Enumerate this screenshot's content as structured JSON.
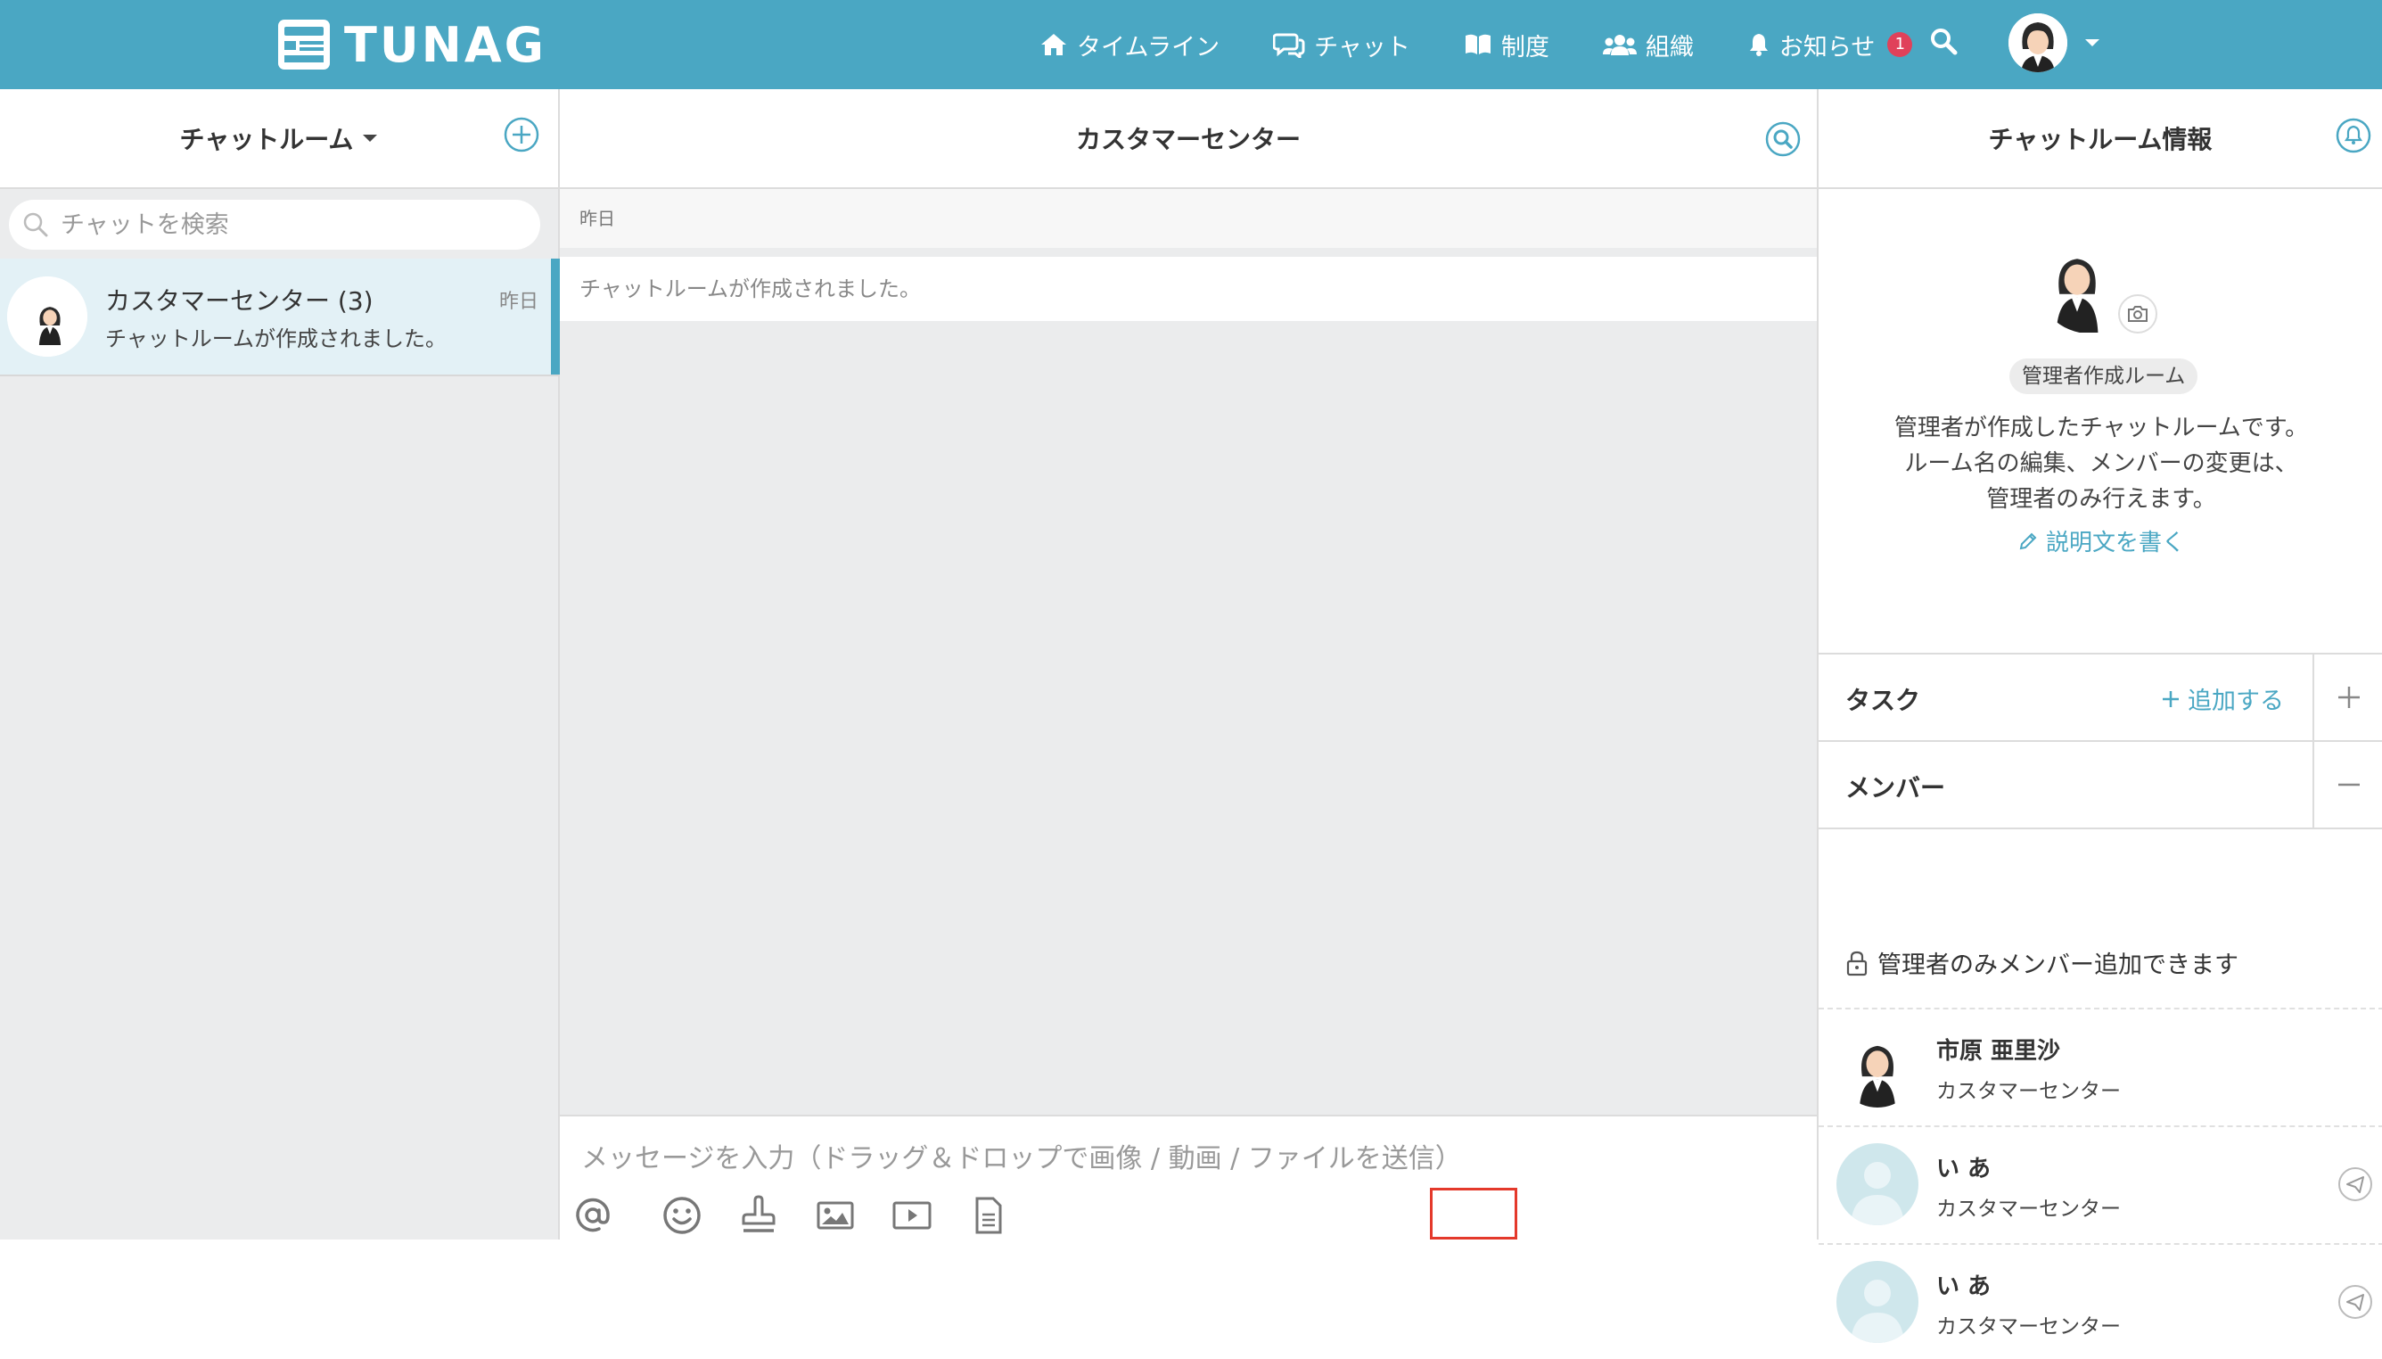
{
  "app": {
    "logo_text": "TUNAG"
  },
  "nav": {
    "items": [
      {
        "label": "タイムライン",
        "icon": "home-icon"
      },
      {
        "label": "チャット",
        "icon": "chat-icon"
      },
      {
        "label": "制度",
        "icon": "book-icon"
      },
      {
        "label": "組織",
        "icon": "users-icon"
      },
      {
        "label": "お知らせ",
        "icon": "bell-icon",
        "badge": "1"
      }
    ],
    "search_icon": "search-icon",
    "avatar_icon": "user-avatar",
    "caret_icon": "caret-down-icon"
  },
  "left": {
    "title": "チャットルーム",
    "search_placeholder": "チャットを検索",
    "rooms": [
      {
        "name": "カスタマーセンター (3)",
        "last_message": "チャットルームが作成されました。",
        "time": "昨日"
      }
    ]
  },
  "main": {
    "title": "カスタマーセンター",
    "date_label": "昨日",
    "system_message": "チャットルームが作成されました。",
    "composer_placeholder": "メッセージを入力（ドラッグ＆ドロップで画像 / 動画 / ファイルを送信）",
    "tools": [
      "mention-icon",
      "emoji-icon",
      "stamp-icon",
      "image-icon",
      "video-icon",
      "file-icon"
    ],
    "send_icon": "send-icon"
  },
  "right": {
    "title": "チャットルーム情報",
    "admin_tag": "管理者作成ルーム",
    "description_lines": [
      "管理者が作成したチャットルームです。",
      "ルーム名の編集、メンバーの変更は、",
      "管理者のみ行えます。"
    ],
    "write_description": "説明文を書く",
    "tasks_label": "タスク",
    "add_task": "追加する",
    "members_label": "メンバー",
    "lock_note": "管理者のみメンバー追加できます",
    "members": [
      {
        "name": "市原 亜里沙",
        "dept": "カスタマーセンター"
      },
      {
        "name": "い あ",
        "dept": "カスタマーセンター"
      },
      {
        "name": "い あ",
        "dept": "カスタマーセンター"
      }
    ]
  },
  "colors": {
    "brand": "#4aa7c3",
    "badge": "#e0415a",
    "highlight": "#e4392b"
  }
}
